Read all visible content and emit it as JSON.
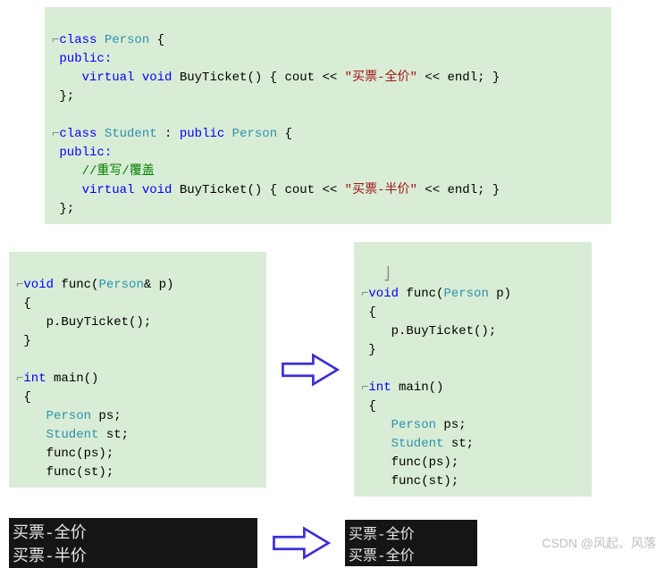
{
  "top_code": {
    "l1a": "class",
    "l1b": "Person",
    "l1c": " {",
    "l2": "public:",
    "l3a": "    virtual",
    "l3b": " void",
    "l3c": " BuyTicket",
    "l3d": "() { cout << ",
    "l3e": "\"买票-全价\"",
    "l3f": " << endl; }",
    "l4": "};",
    "l6a": "class",
    "l6b": " Student",
    "l6c": " : ",
    "l6d": "public",
    "l6e": " Person",
    "l6f": " {",
    "l7": "public:",
    "l8": "    //重写/覆盖",
    "l9a": "    virtual",
    "l9b": " void",
    "l9c": " BuyTicket",
    "l9d": "() { cout << ",
    "l9e": "\"买票-半价\"",
    "l9f": " << endl; }",
    "l10": "};"
  },
  "left_code": {
    "l1a": "void",
    "l1b": " func(",
    "l1c": "Person",
    "l1d": "& p)",
    "l2": "{",
    "l3": "    p.BuyTicket();",
    "l4": "}",
    "l6a": "int",
    "l6b": " main()",
    "l7": "{",
    "l8a": "    Person",
    "l8b": " ps;",
    "l9a": "    Student",
    "l9b": " st;",
    "l10": "    func(ps);",
    "l11": "    func(st);"
  },
  "right_code": {
    "l1a": "void",
    "l1b": " func(",
    "l1c": "Person",
    "l1d": " p)",
    "l2": "{",
    "l3": "    p.BuyTicket();",
    "l4": "}",
    "l6a": "int",
    "l6b": " main()",
    "l7": "{",
    "l8a": "    Person",
    "l8b": " ps;",
    "l9a": "    Student",
    "l9b": " st;",
    "l10": "    func(ps);",
    "l11": "    func(st);"
  },
  "console_left": {
    "line1": "买票-全价",
    "line2": "买票-半价"
  },
  "console_right": {
    "line1": "买票-全价",
    "line2": "买票-全价"
  },
  "watermark": "CSDN @风起、风落"
}
